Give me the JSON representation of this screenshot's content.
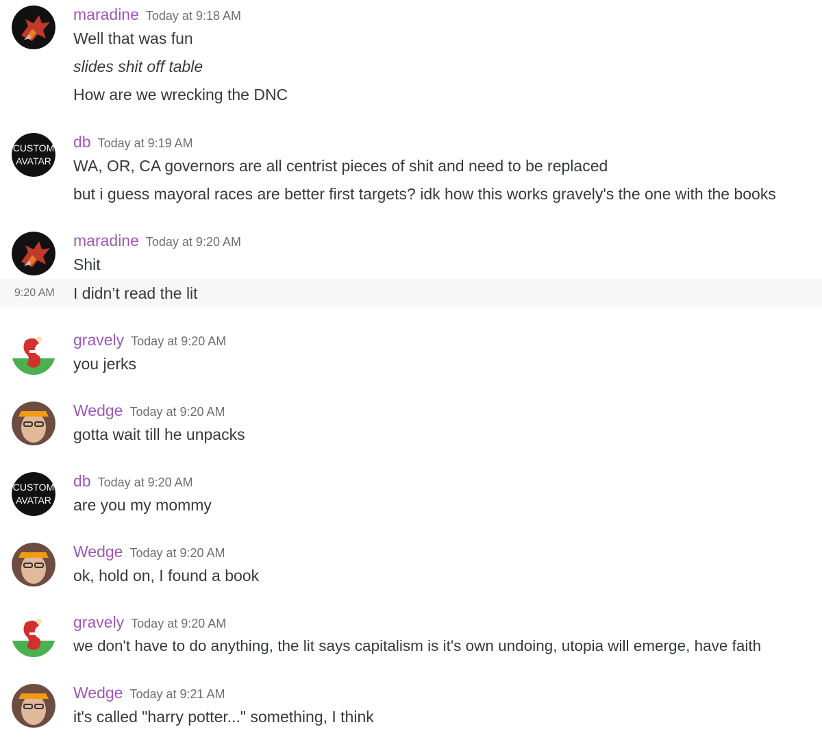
{
  "colors": {
    "username": "#9b59b6",
    "text": "#36393e",
    "timestamp": "#6c6f73",
    "hover_bg": "#f7f7f7"
  },
  "messages": [
    {
      "username": "maradine",
      "timestamp": "Today at 9:18 AM",
      "avatar": "dragon-avatar",
      "lines": [
        "Well that was fun",
        "slides shit off table",
        "How are we wrecking the DNC"
      ]
    },
    {
      "username": "db",
      "timestamp": "Today at 9:19 AM",
      "avatar": "custom-avatar",
      "avatar_text": [
        "CUSTOM",
        "AVATAR"
      ],
      "lines": [
        "WA, OR, CA governors are all centrist pieces of shit and need to be replaced",
        "but i guess mayoral races are better first targets? idk how this works gravely's the one with the books"
      ]
    },
    {
      "username": "maradine",
      "timestamp": "Today at 9:20 AM",
      "avatar": "dragon-avatar",
      "lines": [
        "Shit"
      ],
      "hover_time": "9:20 AM",
      "hover_line": "I didn’t read the lit"
    },
    {
      "username": "gravely",
      "timestamp": "Today at 9:20 AM",
      "avatar": "cartoon-avatar",
      "lines": [
        "you jerks"
      ]
    },
    {
      "username": "Wedge",
      "timestamp": "Today at 9:20 AM",
      "avatar": "photo-avatar",
      "lines": [
        "gotta wait till he unpacks"
      ]
    },
    {
      "username": "db",
      "timestamp": "Today at 9:20 AM",
      "avatar": "custom-avatar",
      "avatar_text": [
        "CUSTOM",
        "AVATAR"
      ],
      "lines": [
        "are you my mommy"
      ]
    },
    {
      "username": "Wedge",
      "timestamp": "Today at 9:20 AM",
      "avatar": "photo-avatar",
      "lines": [
        "ok, hold on, I found a book"
      ]
    },
    {
      "username": "gravely",
      "timestamp": "Today at 9:20 AM",
      "avatar": "cartoon-avatar",
      "lines": [
        "we don't have to do anything, the lit says capitalism is it's own undoing, utopia will emerge, have faith"
      ]
    },
    {
      "username": "Wedge",
      "timestamp": "Today at 9:21 AM",
      "avatar": "photo-avatar",
      "lines": [
        "it's called \"harry potter...\" something, I think"
      ]
    }
  ]
}
